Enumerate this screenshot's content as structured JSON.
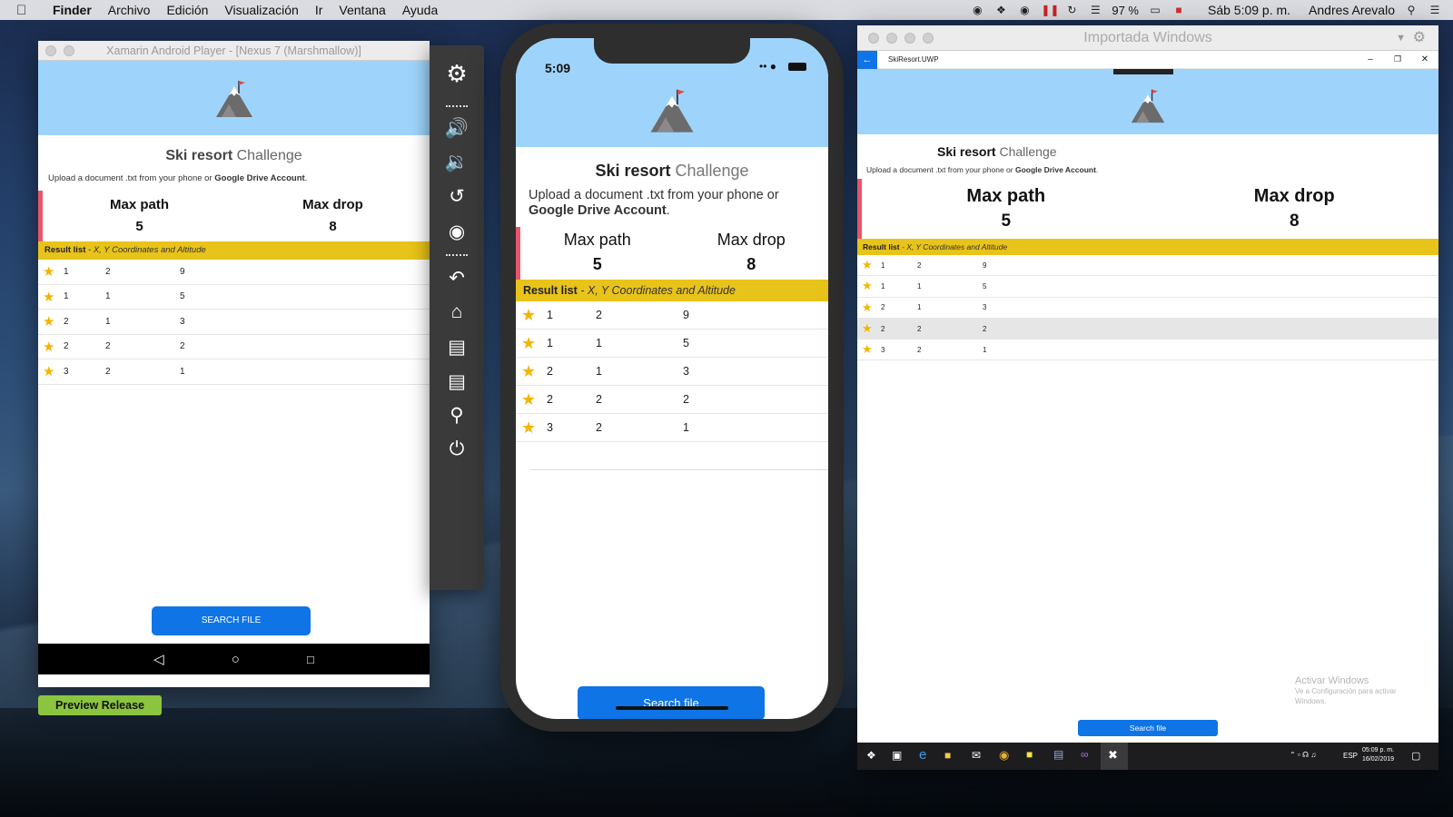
{
  "menubar": {
    "app": "Finder",
    "items": [
      "Archivo",
      "Edición",
      "Visualización",
      "Ir",
      "Ventana",
      "Ayuda"
    ],
    "battery": "97 %",
    "clock": "Sáb 5:09 p. m.",
    "user": "Andres Arevalo"
  },
  "android": {
    "window_title": "Xamarin Android Player - [Nexus 7 (Marshmallow)]",
    "app_title_bold": "Ski resort",
    "app_title_rest": "Challenge",
    "upload_text": "Upload a document .txt from your phone or",
    "upload_bold": "Google Drive Account",
    "max_path_label": "Max path",
    "max_path_value": "5",
    "max_drop_label": "Max drop",
    "max_drop_value": "8",
    "result_label": "Result list",
    "result_desc": "- X, Y Coordinates and Altitude",
    "rows": [
      [
        "1",
        "2",
        "9"
      ],
      [
        "1",
        "1",
        "5"
      ],
      [
        "2",
        "1",
        "3"
      ],
      [
        "2",
        "2",
        "2"
      ],
      [
        "3",
        "2",
        "1"
      ]
    ],
    "button": "SEARCH FILE",
    "preview_button": "Preview Release"
  },
  "iphone": {
    "time": "5:09",
    "app_title_bold": "Ski resort",
    "app_title_rest": "Challenge",
    "upload_text": "Upload a document .txt from your phone or",
    "upload_bold": "Google Drive Account",
    "max_path_label": "Max path",
    "max_path_value": "5",
    "max_drop_label": "Max drop",
    "max_drop_value": "8",
    "result_label": "Result list",
    "result_desc": "- X, Y Coordinates and Altitude",
    "rows": [
      [
        "1",
        "2",
        "9"
      ],
      [
        "1",
        "1",
        "5"
      ],
      [
        "2",
        "1",
        "3"
      ],
      [
        "2",
        "2",
        "2"
      ],
      [
        "3",
        "2",
        "1"
      ]
    ],
    "button": "Search file"
  },
  "windows": {
    "window_title": "Importada Windows",
    "app_name": "SkiResort.UWP",
    "app_title_bold": "Ski resort",
    "app_title_rest": "Challenge",
    "upload_text": "Upload a document .txt from your phone or",
    "upload_bold": "Google Drive Account",
    "max_path_label": "Max path",
    "max_path_value": "5",
    "max_drop_label": "Max drop",
    "max_drop_value": "8",
    "result_label": "Result list",
    "result_desc": "- X, Y Coordinates and Altitude",
    "rows": [
      [
        "1",
        "2",
        "9"
      ],
      [
        "1",
        "1",
        "5"
      ],
      [
        "2",
        "1",
        "3"
      ],
      [
        "2",
        "2",
        "2"
      ],
      [
        "3",
        "2",
        "1"
      ]
    ],
    "button": "Search file",
    "activate_title": "Activar Windows",
    "activate_sub": "Ve a Configuración para activar Windows.",
    "lang": "ESP",
    "task_time": "05:09 p. m.",
    "task_date": "16/02/2019"
  },
  "colors": {
    "header_blue": "#9ed4fb",
    "result_bar": "#e8c31a",
    "button_blue": "#0f74e6",
    "accent_red": "#e8556a"
  }
}
